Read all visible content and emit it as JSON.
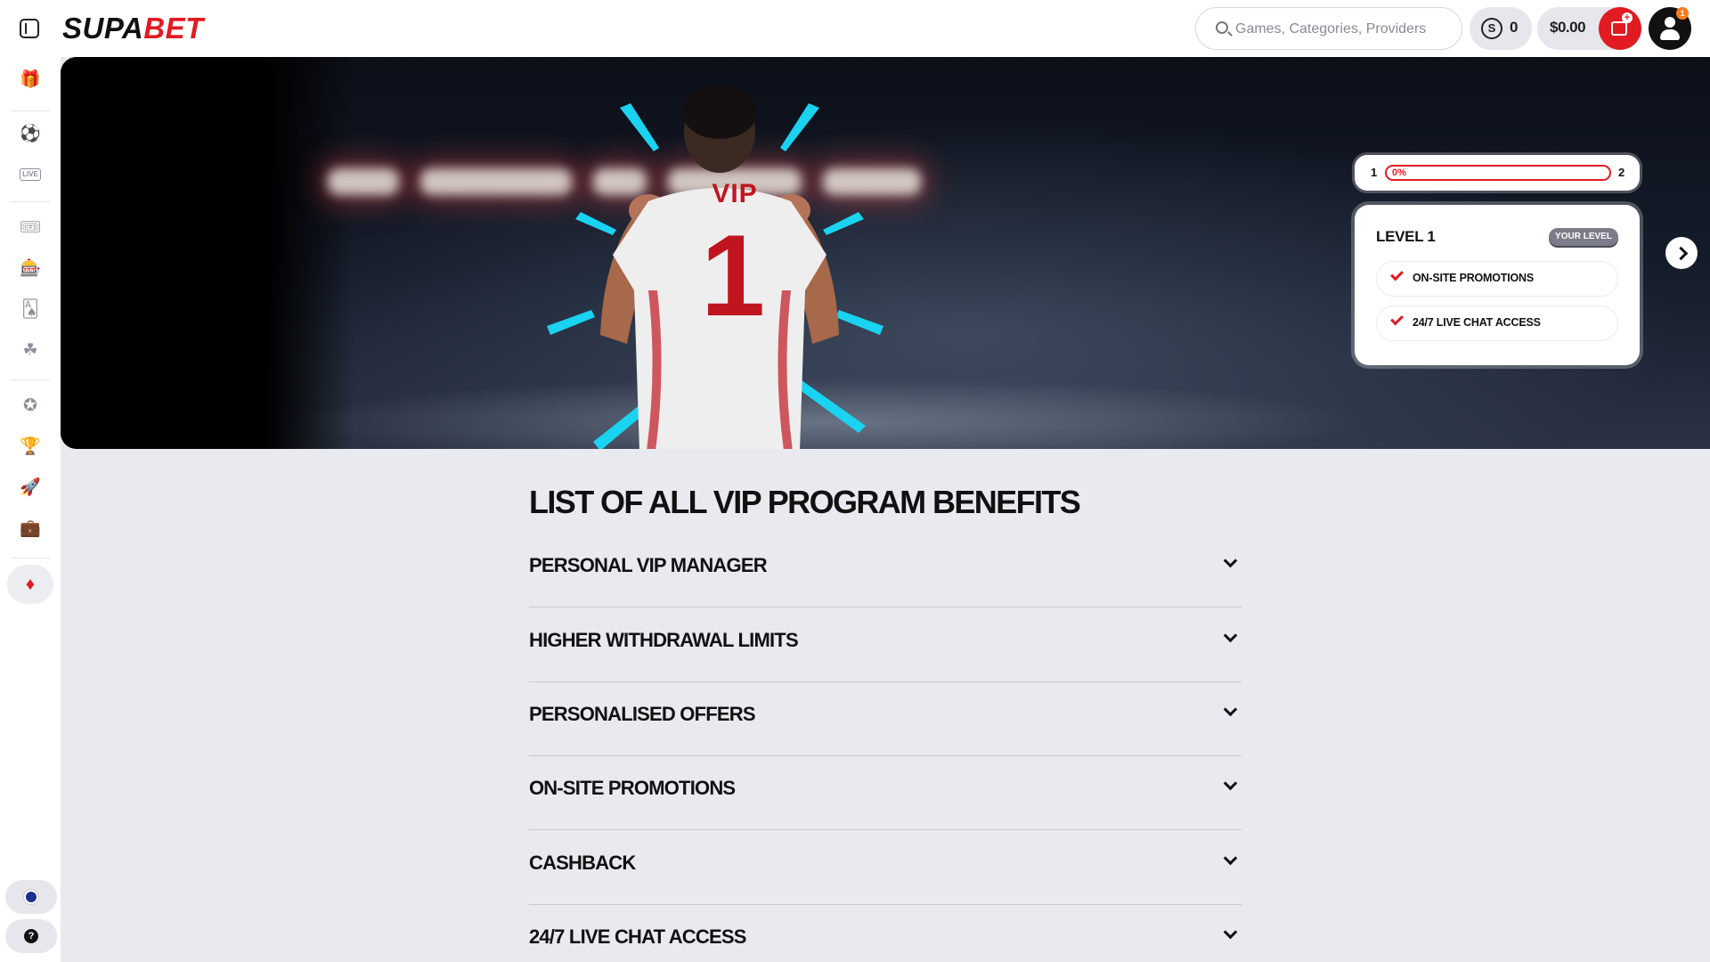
{
  "header": {
    "logo_primary": "SUPA",
    "logo_accent": "BET",
    "search_placeholder": "Games, Categories, Providers",
    "coins_count": "0",
    "balance": "$0.00",
    "notification_count": "1"
  },
  "sidebar": {
    "items": [
      {
        "icon": "gift-icon"
      },
      {
        "icon": "soccer-ball-icon"
      },
      {
        "icon": "live-icon",
        "label": "LIVE"
      },
      {
        "icon": "ticket-icon"
      },
      {
        "icon": "slot-machine-icon"
      },
      {
        "icon": "cards-icon"
      },
      {
        "icon": "clover-icon"
      },
      {
        "icon": "star-badge-icon"
      },
      {
        "icon": "trophy-icon"
      },
      {
        "icon": "rocket-icon"
      },
      {
        "icon": "treasure-chest-icon"
      },
      {
        "icon": "gem-icon",
        "active": true
      }
    ],
    "bottom": [
      {
        "icon": "australia-flag-icon"
      },
      {
        "icon": "help-icon",
        "label": "?"
      }
    ]
  },
  "hero": {
    "shirt_text": "VIP",
    "shirt_number": "1",
    "progress": {
      "from_level": "1",
      "to_level": "2",
      "percent_label": "0%",
      "percent": 0
    },
    "level_card": {
      "title": "LEVEL 1",
      "badge": "YOUR LEVEL",
      "perks": [
        "ON-SITE PROMOTIONS",
        "24/7 LIVE CHAT ACCESS"
      ]
    }
  },
  "benefits": {
    "title": "LIST OF ALL VIP PROGRAM BENEFITS",
    "items": [
      "PERSONAL VIP MANAGER",
      "HIGHER WITHDRAWAL LIMITS",
      "PERSONALISED OFFERS",
      "ON-SITE PROMOTIONS",
      "CASHBACK",
      "24/7 LIVE CHAT ACCESS"
    ]
  },
  "colors": {
    "brand_red": "#e21a22",
    "accent_cyan": "#19d3f0",
    "page_bg": "#e9eaef"
  }
}
